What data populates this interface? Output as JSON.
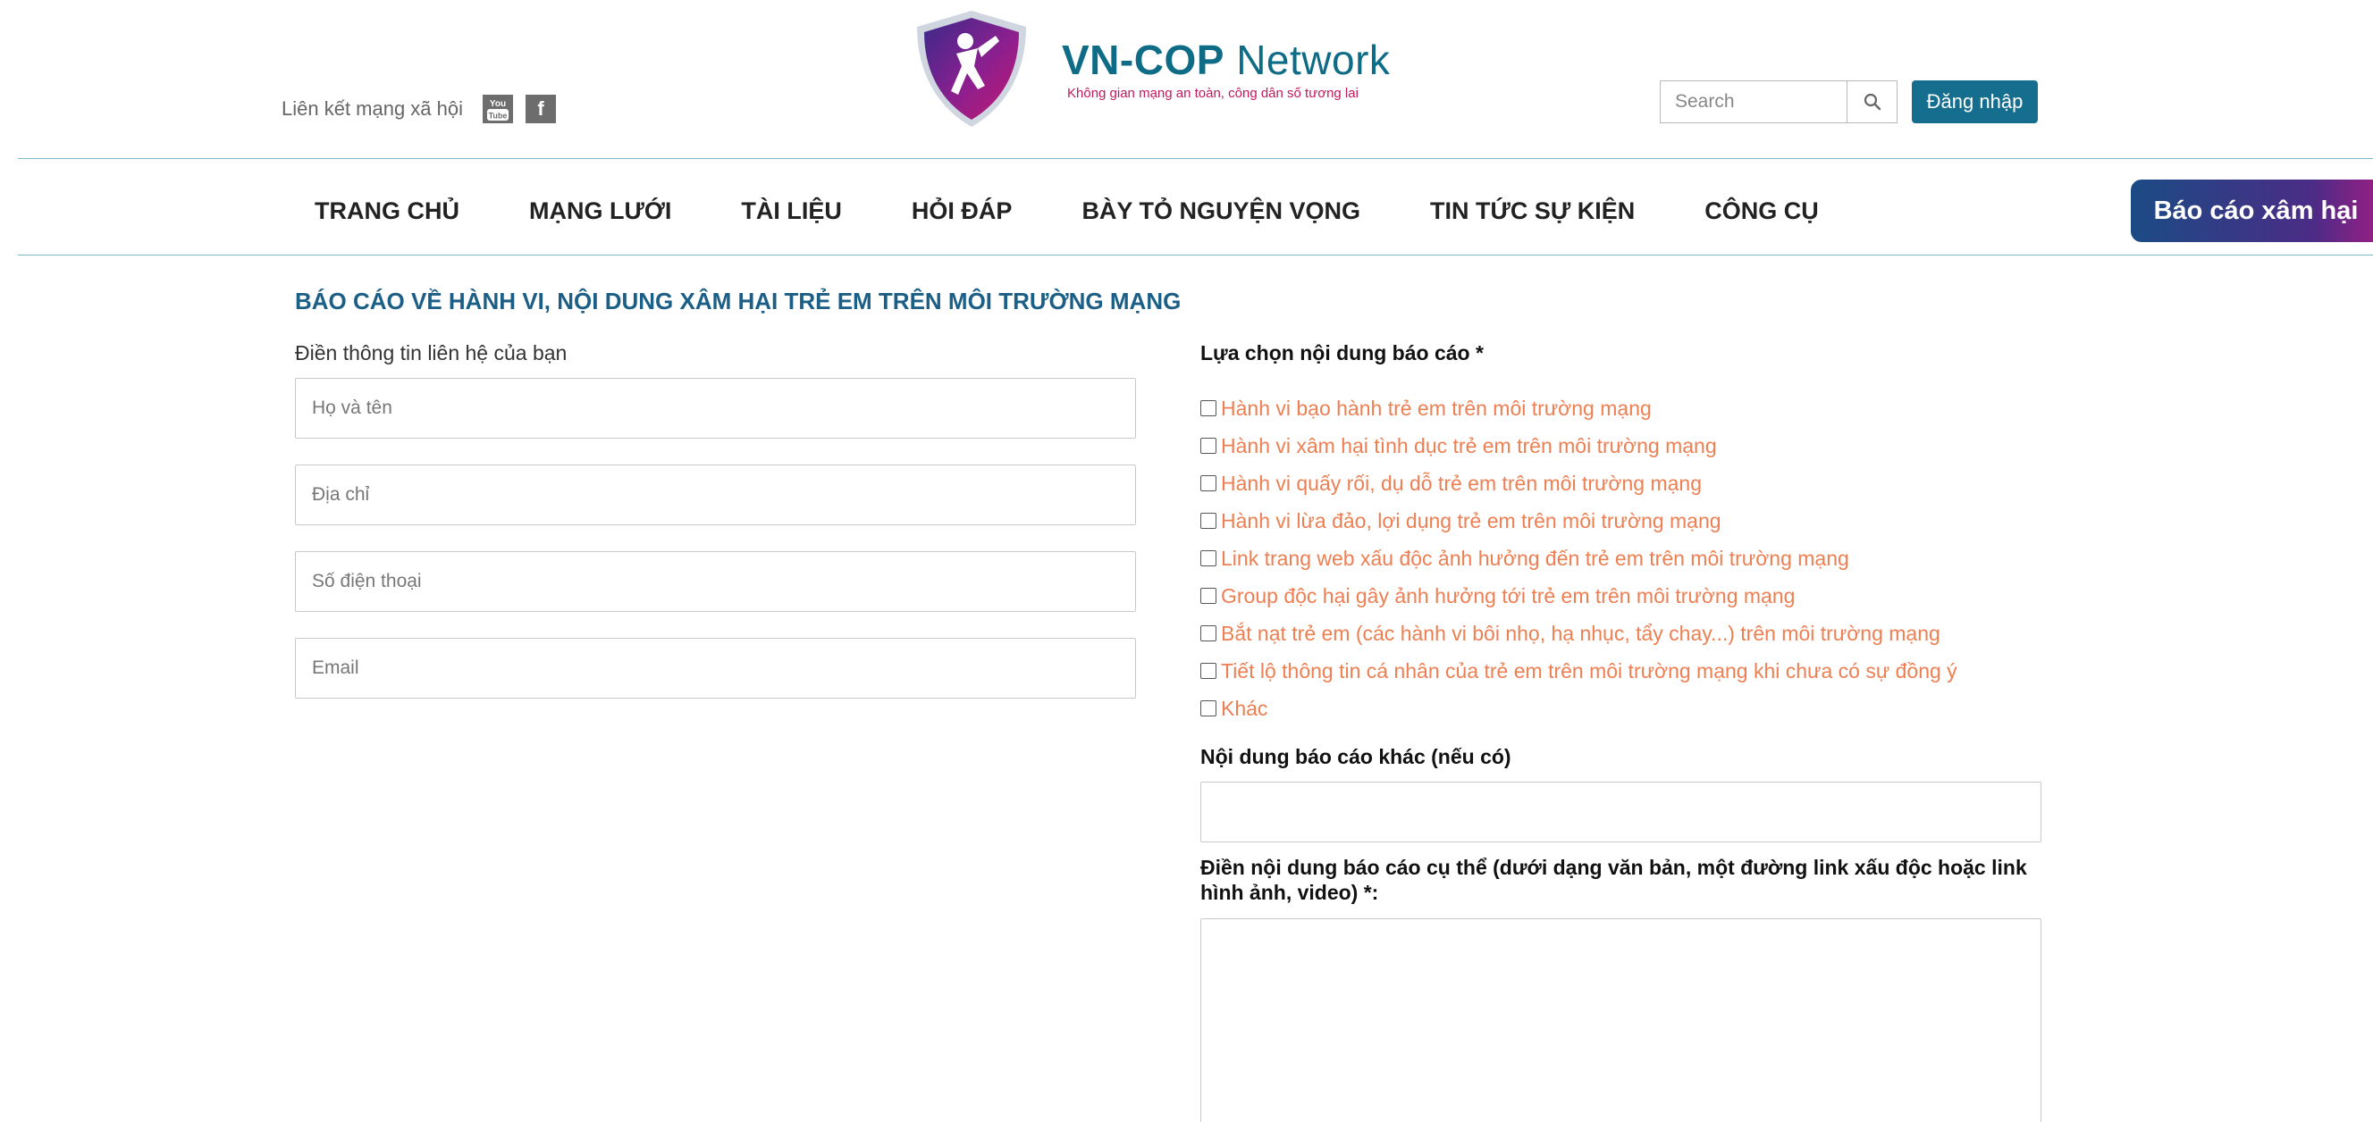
{
  "header": {
    "social_label": "Liên kết mạng xã hội",
    "social_icons": [
      "youtube-icon",
      "facebook-icon"
    ],
    "facebook_glyph": "f",
    "youtube_glyph_top": "You",
    "youtube_glyph_bottom": "Tube",
    "logo": {
      "title_bold": "VN-COP",
      "title_light": "Network",
      "subtitle": "Không gian mạng an toàn, công dân số tương lai"
    },
    "search": {
      "placeholder": "Search"
    },
    "login_label": "Đăng nhập"
  },
  "nav": {
    "items": [
      {
        "label": "TRANG CHỦ"
      },
      {
        "label": "MẠNG LƯỚI"
      },
      {
        "label": "TÀI LIỆU"
      },
      {
        "label": "HỎI ĐÁP"
      },
      {
        "label": "BÀY TỎ NGUYỆN VỌNG"
      },
      {
        "label": "TIN TỨC SỰ KIỆN"
      },
      {
        "label": "CÔNG CỤ"
      }
    ],
    "report_button": "Báo cáo xâm hại"
  },
  "form": {
    "title": "BÁO CÁO VỀ HÀNH VI, NỘI DUNG XÂM HẠI TRẺ EM TRÊN MÔI TRƯỜNG MẠNG",
    "contact_label": "Điền thông tin liên hệ của bạn",
    "fields": [
      {
        "placeholder": "Họ và tên",
        "value": ""
      },
      {
        "placeholder": "Địa chỉ",
        "value": ""
      },
      {
        "placeholder": "Số điện thoại",
        "value": ""
      },
      {
        "placeholder": "Email",
        "value": ""
      }
    ],
    "choose_label": "Lựa chọn nội dung báo cáo *",
    "options": [
      {
        "label": "Hành vi bạo hành trẻ em trên môi trường mạng",
        "checked": false
      },
      {
        "label": "Hành vi xâm hại tình dục trẻ em trên môi trường mạng",
        "checked": false
      },
      {
        "label": "Hành vi quấy rối, dụ dỗ trẻ em trên môi trường mạng",
        "checked": false
      },
      {
        "label": "Hành vi lừa đảo, lợi dụng trẻ em trên môi trường mạng",
        "checked": false
      },
      {
        "label": "Link trang web xấu độc ảnh hưởng đến trẻ em trên môi trường mạng",
        "checked": false
      },
      {
        "label": "Group độc hại gây ảnh hưởng tới trẻ em trên môi trường mạng",
        "checked": false
      },
      {
        "label": "Bắt nạt trẻ em (các hành vi bôi nhọ, hạ nhục, tẩy chay...) trên môi trường mạng",
        "checked": false
      },
      {
        "label": "Tiết lộ thông tin cá nhân của trẻ em trên môi trường mạng khi chưa có sự đồng ý",
        "checked": false
      },
      {
        "label": "Khác",
        "checked": false
      }
    ],
    "other_label": "Nội dung báo cáo khác (nếu có)",
    "other_value": "",
    "detail_label": "Điền nội dung báo cáo cụ thể (dưới dạng văn bản, một đường link xấu độc hoặc link hình ảnh, video) *:",
    "detail_value": ""
  },
  "colors": {
    "brand_teal": "#0f6c86",
    "login_button": "#166e8e",
    "title_blue": "#1b5e86",
    "option_orange": "#ed7f52",
    "report_gradient_start": "#1b4b84",
    "report_gradient_end": "#a51c84",
    "logo_subtitle": "#c2185b"
  }
}
